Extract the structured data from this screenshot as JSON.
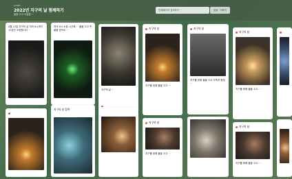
{
  "header": {
    "small_text": "padlet ···",
    "title": "2022년 지구의 날 함께하기",
    "subtitle": "불을 끄고 소등을 ···",
    "search_placeholder": "전체페이지 검색하기 ···",
    "share_label": "공유 · 더보기"
  },
  "cards": [
    {
      "caption": "4월 22일 지구의 날 저녁 8시부터 10분간 소등합니다 ···"
    },
    {
      "caption": "저녁 8시 소등 시간에 ··· 불을 끄고 촛불을 켰어요 ···"
    },
    {
      "caption": "지구의 날 ···"
    },
    {
      "tag": "지구의 날",
      "caption": "지구를 위해 불을 끄고 ···"
    },
    {
      "tag": "지구의 날",
      "caption": "지구를 위해 불을 끄고 가족과 함께 ···"
    },
    {
      "tag": "지구의 날",
      "caption": "지구를 위해 불을 끄고 ···"
    },
    {
      "tag": "지구의 날"
    },
    {
      "tag": "지구의 날 참여"
    },
    {
      "tag": "지구의 날",
      "caption": "지구를 위해 불을 끄고 ···"
    },
    {
      "tag": "지구의 날 참여 ···",
      "caption": ""
    },
    {
      "tag": "지구의 날 참여",
      "caption": "지구를 위해 불을 끄고 ···"
    },
    {
      "tag": "지구의 날",
      "caption": "지구를 위해 불을 끄고 ···"
    },
    {
      "tag": "지구의 날",
      "caption": ""
    },
    {
      "tag": "지구의 날",
      "caption": ""
    },
    {
      "tag": "지구의 날"
    }
  ],
  "colors": {
    "board_bg": "#4f7551",
    "topbar": "#465f46",
    "accent": "#e2583e"
  }
}
